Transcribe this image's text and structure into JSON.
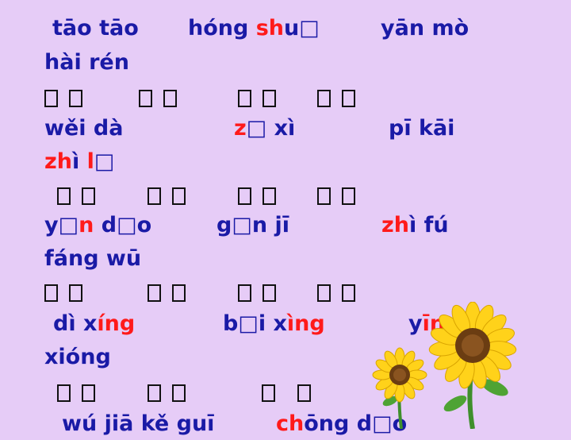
{
  "background_color": "#e6ccf7",
  "pinyin_color": "#1a1aa6",
  "highlight_color": "#ff1a1a",
  "rows": [
    {
      "segments": [
        {
          "parts": [
            {
              "t": "tāo tāo",
              "hl": false
            }
          ]
        },
        {
          "parts": [
            {
              "t": "hóng ",
              "hl": false
            },
            {
              "t": "sh",
              "hl": true
            },
            {
              "t": "u",
              "hl": false
            },
            {
              "t": "□",
              "hl": false
            }
          ]
        },
        {
          "parts": [
            {
              "t": "yān mò",
              "hl": false
            }
          ]
        }
      ]
    },
    {
      "segments": [
        {
          "parts": [
            {
              "t": "hài rén",
              "hl": false
            }
          ]
        }
      ]
    },
    {
      "boxes": [
        2,
        2,
        2,
        2
      ]
    },
    {
      "segments": [
        {
          "parts": [
            {
              "t": "wěi dà",
              "hl": false
            }
          ]
        },
        {
          "parts": [
            {
              "t": "z",
              "hl": true
            },
            {
              "t": "□",
              "hl": false
            },
            {
              "t": " xì",
              "hl": false
            }
          ]
        },
        {
          "parts": [
            {
              "t": "pī kāi",
              "hl": false
            }
          ]
        }
      ]
    },
    {
      "segments": [
        {
          "parts": [
            {
              "t": "zh",
              "hl": true
            },
            {
              "t": "ì  ",
              "hl": false
            },
            {
              "t": "l",
              "hl": true
            },
            {
              "t": "□",
              "hl": false
            }
          ]
        }
      ]
    },
    {
      "boxes": [
        2,
        2,
        2,
        2
      ]
    },
    {
      "segments": [
        {
          "parts": [
            {
              "t": "y",
              "hl": false
            },
            {
              "t": "□",
              "hl": false
            },
            {
              "t": "n",
              "hl": true
            },
            {
              "t": " d",
              "hl": false
            },
            {
              "t": "□",
              "hl": false
            },
            {
              "t": "o",
              "hl": false
            }
          ]
        },
        {
          "parts": [
            {
              "t": "g",
              "hl": false
            },
            {
              "t": "□",
              "hl": false
            },
            {
              "t": "n  jī",
              "hl": false
            }
          ]
        },
        {
          "parts": [
            {
              "t": "zh",
              "hl": true
            },
            {
              "t": "ì fú",
              "hl": false
            }
          ]
        }
      ]
    },
    {
      "segments": [
        {
          "parts": [
            {
              "t": "fáng wū",
              "hl": false
            }
          ]
        }
      ]
    },
    {
      "boxes": [
        2,
        2,
        2,
        2
      ]
    },
    {
      "segments": [
        {
          "parts": [
            {
              "t": "dì  x",
              "hl": false
            },
            {
              "t": "íng",
              "hl": true
            }
          ]
        },
        {
          "parts": [
            {
              "t": "b",
              "hl": false
            },
            {
              "t": "□",
              "hl": false
            },
            {
              "t": "i  x",
              "hl": false
            },
            {
              "t": "ìng",
              "hl": true
            }
          ]
        },
        {
          "parts": [
            {
              "t": "y",
              "hl": false
            },
            {
              "t": "īng",
              "hl": true
            }
          ]
        }
      ]
    },
    {
      "segments": [
        {
          "parts": [
            {
              "t": "xióng",
              "hl": false
            }
          ]
        }
      ]
    },
    {
      "boxes": [
        2,
        2,
        1,
        1
      ]
    },
    {
      "segments": [
        {
          "parts": [
            {
              "t": "wú jiā kě guī",
              "hl": false
            }
          ]
        },
        {
          "parts": [
            {
              "t": "ch",
              "hl": true
            },
            {
              "t": "ōng  d",
              "hl": false
            },
            {
              "t": "□",
              "hl": false
            },
            {
              "t": "o",
              "hl": false
            }
          ]
        }
      ]
    }
  ]
}
